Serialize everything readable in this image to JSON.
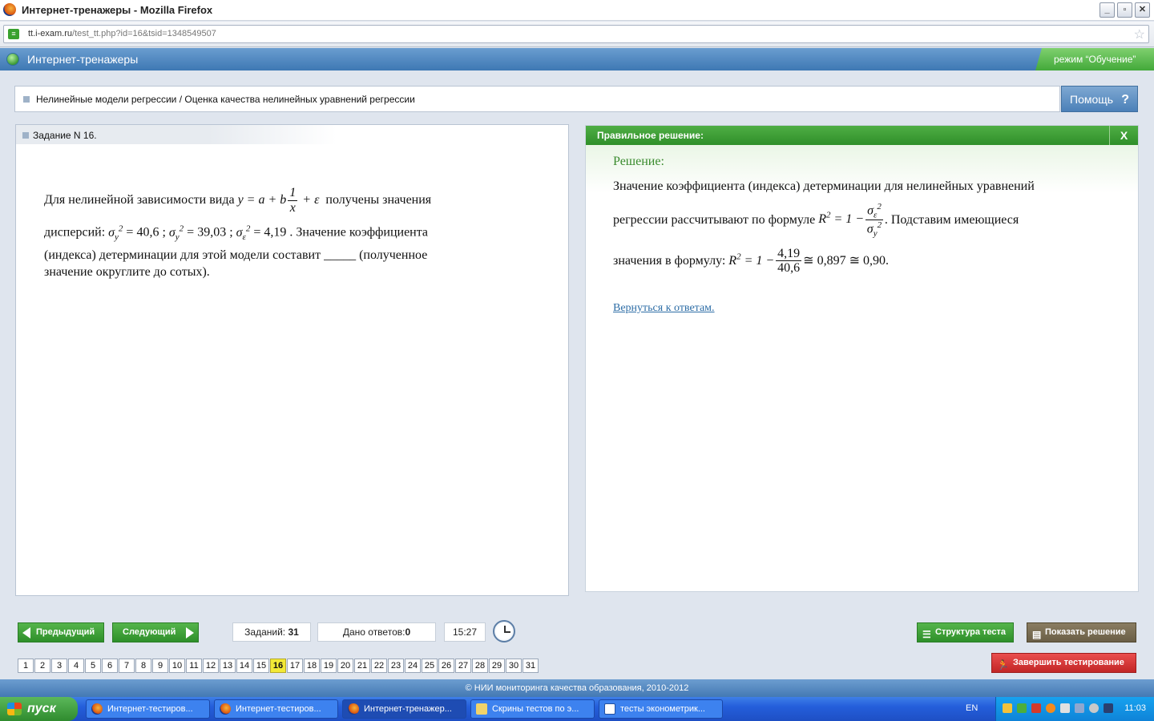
{
  "window": {
    "title": "Интернет-тренажеры - Mozilla Firefox",
    "url_host": "tt.i-exam.ru",
    "url_path": "/test_tt.php?id=16&tsid=1348549507"
  },
  "app": {
    "title": "Интернет-тренажеры",
    "mode": "режим “Обучение”"
  },
  "breadcrumb": "Нелинейные модели регрессии / Оценка качества нелинейных уравнений регрессии",
  "help_label": "Помощь",
  "task": {
    "header": "Задание N 16.",
    "t1": "Для нелинейной зависимости вида",
    "formula_lhs": "y = a + b",
    "frac_num": "1",
    "frac_den": "x",
    "formula_rhs": "+ ε",
    "t2": "получены значения",
    "t3": "дисперсий:",
    "v1": "= 40,6 ;",
    "v2": "= 39,03 ;",
    "v3": "= 4,19 .",
    "t4": "Значение коэффициента",
    "t5": "(индекса) детерминации для этой модели составит _____ (полученное",
    "t6": "значение округлите до сотых)."
  },
  "solution": {
    "header": "Правильное решение:",
    "close": "X",
    "heading": "Решение:",
    "s1": "Значение коэффициента (индекса) детерминации для нелинейных уравнений",
    "s2": "регрессии рассчитывают по формуле",
    "s3": ". Подставим имеющиеся",
    "s4": "значения в формулу:",
    "f_num": "4,19",
    "f_den": "40,6",
    "f_result": "≅ 0,897 ≅ 0,90.",
    "back": "Вернуться к ответам."
  },
  "nav": {
    "prev": "Предыдущий",
    "next": "Следующий",
    "tasks_label": "Заданий:",
    "tasks_value": "31",
    "answers_label": "Дано ответов:",
    "answers_value": "0",
    "time": "15:27",
    "structure": "Структура теста",
    "show_solution": "Показать решение",
    "finish": "Завершить тестирование",
    "pages": [
      "1",
      "2",
      "3",
      "4",
      "5",
      "6",
      "7",
      "8",
      "9",
      "10",
      "11",
      "12",
      "13",
      "14",
      "15",
      "16",
      "17",
      "18",
      "19",
      "20",
      "21",
      "22",
      "23",
      "24",
      "25",
      "26",
      "27",
      "28",
      "29",
      "30",
      "31"
    ],
    "active_page": "16"
  },
  "footer": "© НИИ мониторинга качества образования, 2010-2012",
  "taskbar": {
    "start": "пуск",
    "tasks": [
      "Интернет-тестиров...",
      "Интернет-тестиров...",
      "Интернет-тренажер...",
      "Скрины тестов по э...",
      "тесты эконометрик..."
    ],
    "lang": "EN",
    "clock": "11:03"
  }
}
